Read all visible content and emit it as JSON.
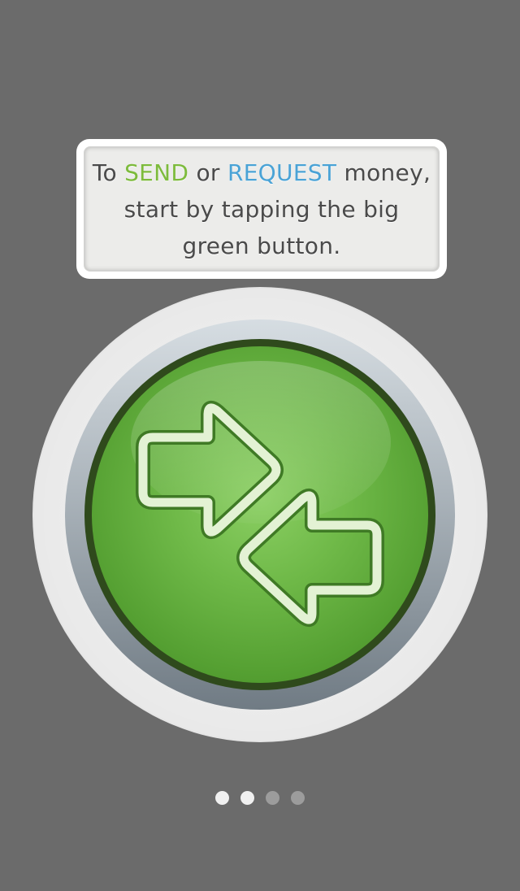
{
  "tip": {
    "prefix": "To ",
    "send_word": "SEND",
    "middle": " or ",
    "request_word": "REQUEST",
    "line1_suffix": " money,",
    "line2": "start by tapping the big",
    "line3": "green button."
  },
  "main_button": {
    "icon": "exchange-arrows-icon"
  },
  "pager": {
    "count": 4,
    "active": [
      0,
      1
    ]
  },
  "colors": {
    "background": "#6b6b6b",
    "send": "#7dbb3c",
    "request": "#4aa3d6",
    "button_green": "#6fb948"
  }
}
